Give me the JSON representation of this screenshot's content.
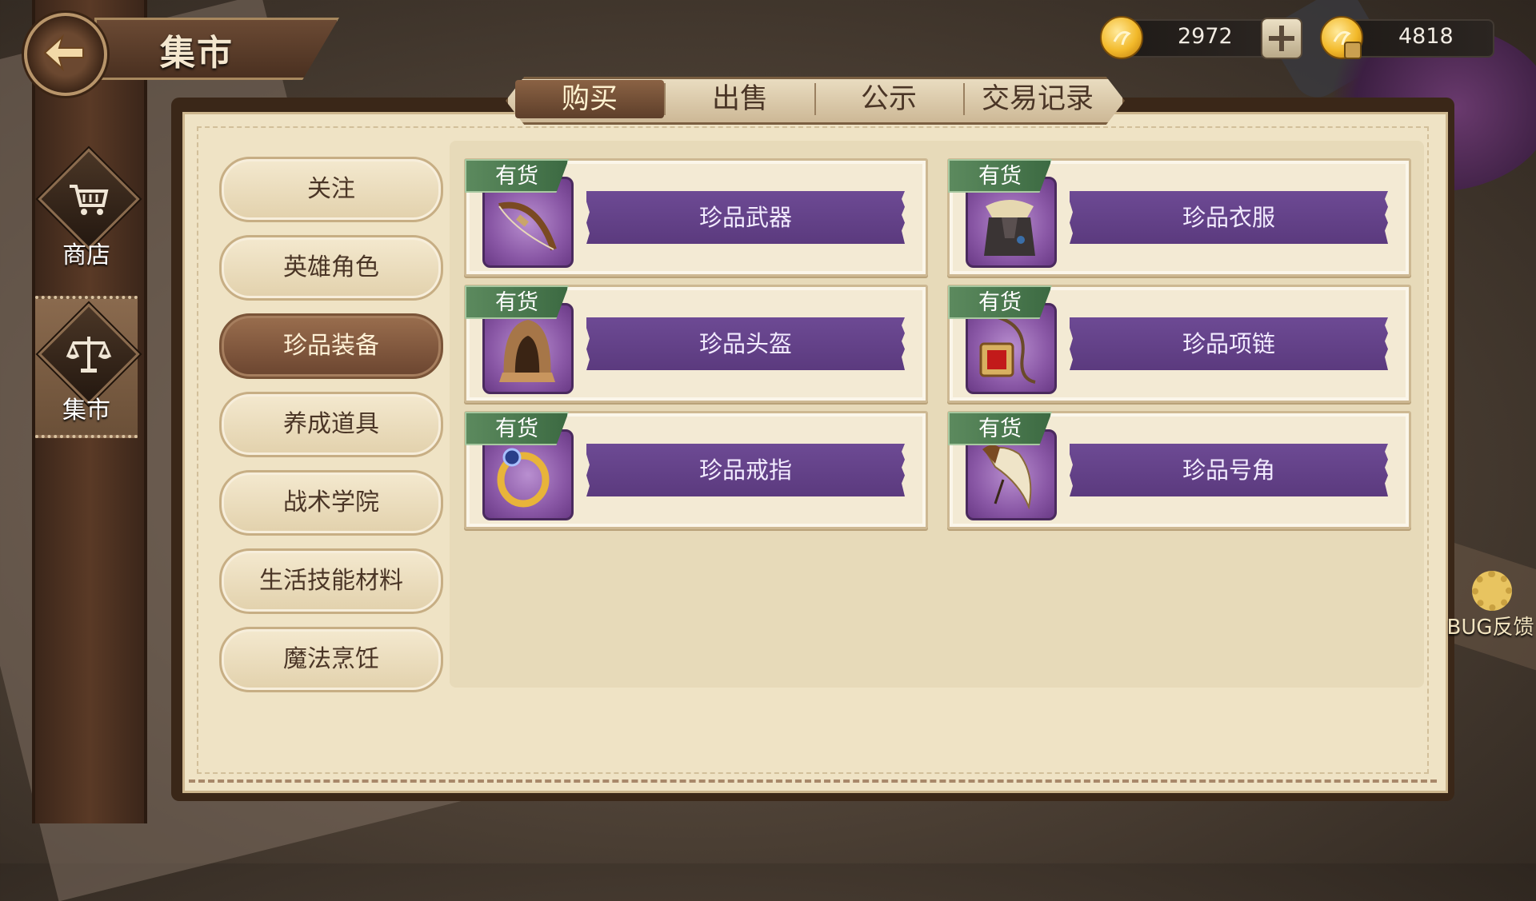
{
  "header": {
    "title": "集市"
  },
  "currency": {
    "gold": "2972",
    "bound_gold": "4818"
  },
  "sidebar": {
    "items": [
      {
        "label": "商店",
        "icon": "shop-cart-icon"
      },
      {
        "label": "集市",
        "icon": "scales-icon",
        "active": true
      }
    ]
  },
  "tabs": [
    {
      "label": "购买",
      "active": true
    },
    {
      "label": "出售"
    },
    {
      "label": "公示"
    },
    {
      "label": "交易记录"
    }
  ],
  "categories": [
    {
      "label": "关注"
    },
    {
      "label": "英雄角色"
    },
    {
      "label": "珍品装备",
      "active": true
    },
    {
      "label": "养成道具"
    },
    {
      "label": "战术学院"
    },
    {
      "label": "生活技能材料"
    },
    {
      "label": "魔法烹饪"
    }
  ],
  "items": [
    {
      "stock": "有货",
      "name": "珍品武器",
      "icon": "bow-icon"
    },
    {
      "stock": "有货",
      "name": "珍品衣服",
      "icon": "armor-icon"
    },
    {
      "stock": "有货",
      "name": "珍品头盔",
      "icon": "hood-icon"
    },
    {
      "stock": "有货",
      "name": "珍品项链",
      "icon": "necklace-icon"
    },
    {
      "stock": "有货",
      "name": "珍品戒指",
      "icon": "ring-icon"
    },
    {
      "stock": "有货",
      "name": "珍品号角",
      "icon": "horn-icon"
    }
  ],
  "bug_feedback": {
    "label": "BUG反馈"
  },
  "colors": {
    "accent_purple": "#5b3a7e",
    "stock_green": "#3c6a42",
    "active_brown": "#6b4530"
  }
}
